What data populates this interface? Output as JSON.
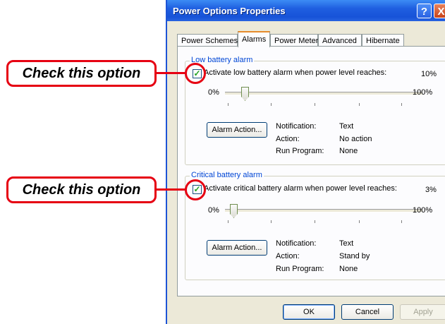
{
  "window": {
    "title": "Power Options Properties",
    "help_label": "?",
    "close_label": "X"
  },
  "tabs": [
    {
      "label": "Power Schemes",
      "active": false
    },
    {
      "label": "Alarms",
      "active": true
    },
    {
      "label": "Power Meter",
      "active": false
    },
    {
      "label": "Advanced",
      "active": false
    },
    {
      "label": "Hibernate",
      "active": false
    }
  ],
  "low_alarm": {
    "group_title": "Low battery alarm",
    "checkbox_label": "Activate low battery alarm when power level reaches:",
    "checked": true,
    "level_text": "10%",
    "slider_min": "0%",
    "slider_max": "100%",
    "slider_value": 0.1,
    "button_label": "Alarm Action...",
    "notification_label": "Notification:",
    "notification_value": "Text",
    "action_label": "Action:",
    "action_value": "No action",
    "run_label": "Run Program:",
    "run_value": "None"
  },
  "critical_alarm": {
    "group_title": "Critical battery alarm",
    "checkbox_label": "Activate critical battery alarm when power level reaches:",
    "checked": true,
    "level_text": "3%",
    "slider_min": "0%",
    "slider_max": "100%",
    "slider_value": 0.03,
    "button_label": "Alarm Action...",
    "notification_label": "Notification:",
    "notification_value": "Text",
    "action_label": "Action:",
    "action_value": "Stand by",
    "run_label": "Run Program:",
    "run_value": "None"
  },
  "footer": {
    "ok_label": "OK",
    "cancel_label": "Cancel",
    "apply_label": "Apply"
  },
  "annotations": {
    "callout_1": "Check this option",
    "callout_2": "Check this option"
  },
  "colors": {
    "annotation_red": "#e60012",
    "titlebar_blue": "#1f5fe0",
    "group_title_blue": "#0046d5"
  }
}
